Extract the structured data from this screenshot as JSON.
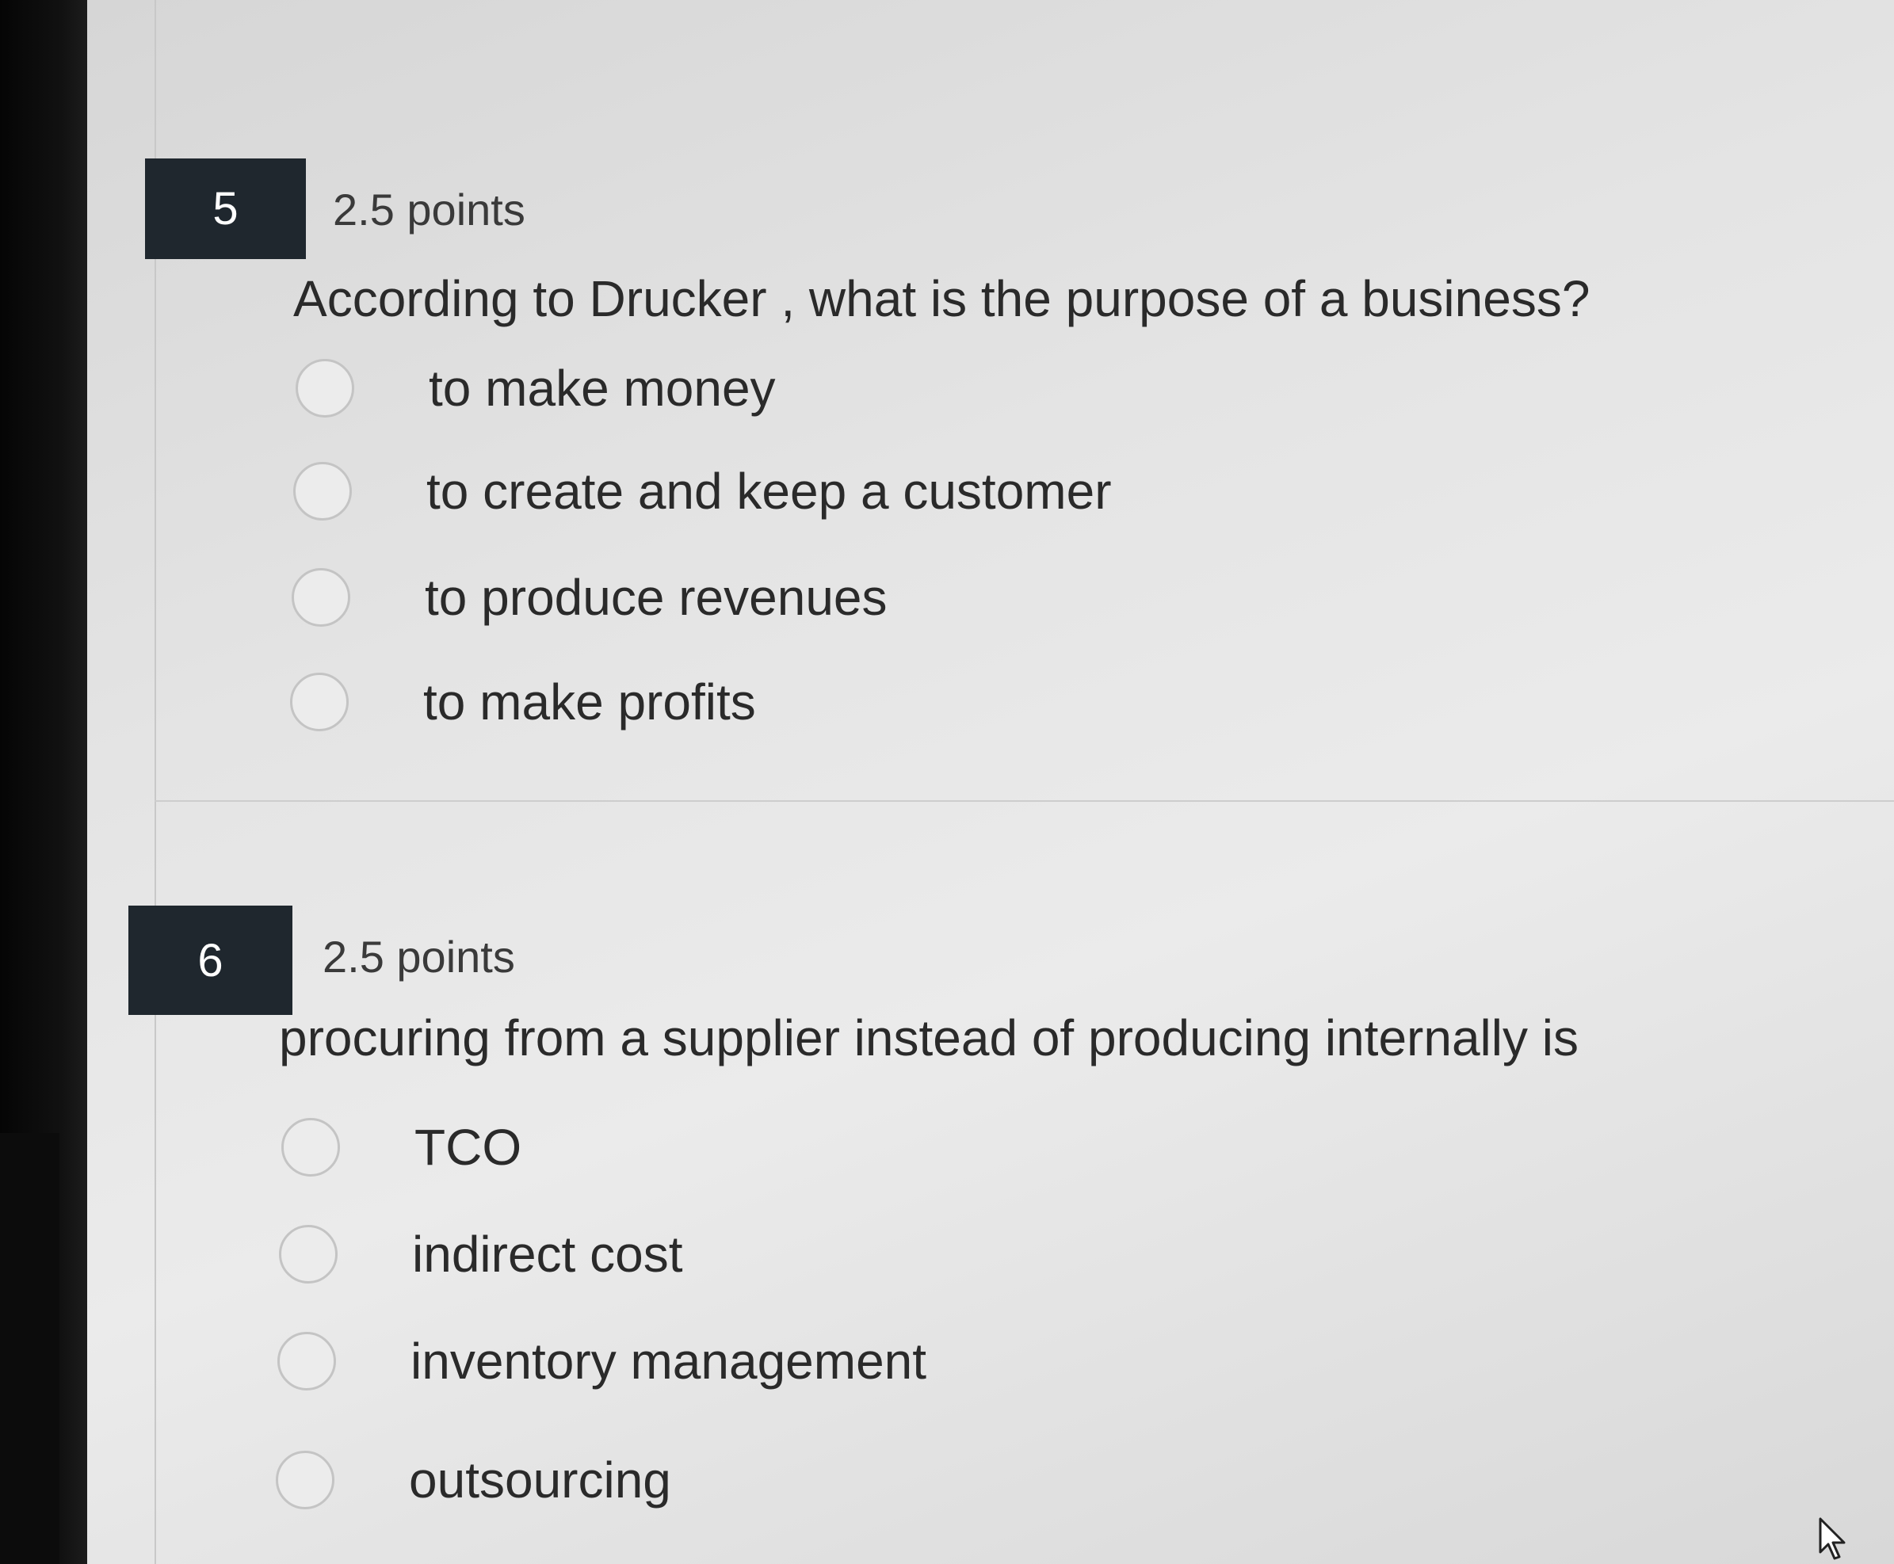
{
  "questions": [
    {
      "number": "5",
      "points": "2.5 points",
      "prompt": "According to Drucker , what is the purpose of a business?",
      "options": [
        "to make money",
        "to create and keep a customer",
        "to produce revenues",
        "to make profits"
      ]
    },
    {
      "number": "6",
      "points": "2.5 points",
      "prompt": "procuring from a supplier instead of producing internally is",
      "options": [
        "TCO",
        "indirect cost",
        "inventory management",
        "outsourcing"
      ]
    }
  ],
  "colors": {
    "number_badge": "#1f272e",
    "radio_border": "#c4c4c4",
    "text": "#2a2a2a"
  },
  "icons": {
    "cursor": "mouse-pointer-icon"
  }
}
